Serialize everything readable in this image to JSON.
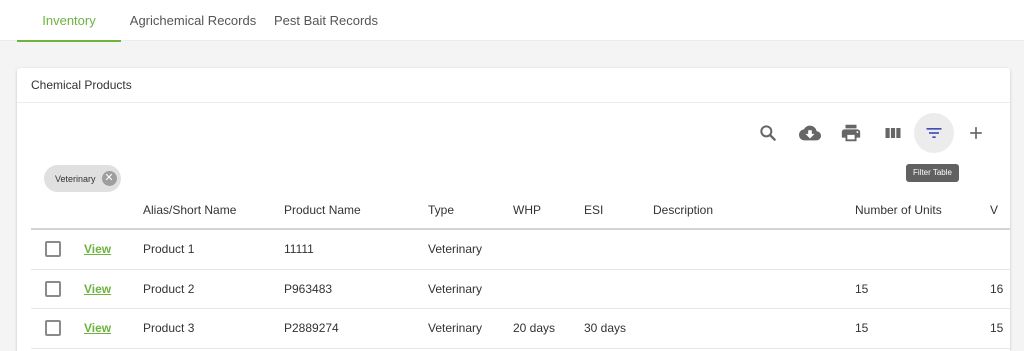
{
  "tabs": [
    {
      "label": "Inventory",
      "active": true
    },
    {
      "label": "Agrichemical Records",
      "active": false
    },
    {
      "label": "Pest Bait Records",
      "active": false
    }
  ],
  "card": {
    "title": "Chemical Products"
  },
  "toolbar": {
    "icons": [
      "search-icon",
      "cloud-download-icon",
      "print-icon",
      "view-columns-icon",
      "filter-list-icon",
      "add-icon"
    ],
    "tooltip": "Filter Table"
  },
  "filter_chip": {
    "label": "Veterinary"
  },
  "table": {
    "columns": [
      "",
      "",
      "Alias/Short Name",
      "Product Name",
      "Type",
      "WHP",
      "ESI",
      "Description",
      "Number of Units",
      "V"
    ],
    "view_label": "View",
    "rows": [
      {
        "alias": "Product 1",
        "product_name": "11111",
        "type": "Veterinary",
        "whp": "",
        "esi": "",
        "description": "",
        "units": "",
        "extra": ""
      },
      {
        "alias": "Product 2",
        "product_name": "P963483",
        "type": "Veterinary",
        "whp": "",
        "esi": "",
        "description": "",
        "units": "15",
        "extra": "16"
      },
      {
        "alias": "Product 3",
        "product_name": "P2889274",
        "type": "Veterinary",
        "whp": "20 days",
        "esi": "30 days",
        "description": "",
        "units": "15",
        "extra": "15"
      }
    ]
  },
  "colors": {
    "accent": "#6db33f",
    "filter_icon": "#3f51b5"
  }
}
